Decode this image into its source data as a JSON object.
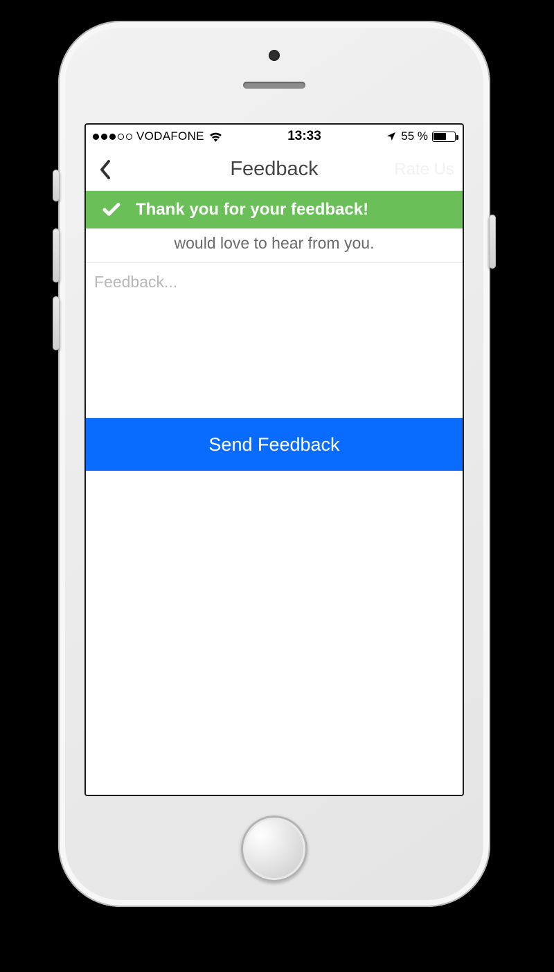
{
  "status": {
    "carrier": "VODAFONE",
    "time": "13:33",
    "battery_text": "55 %",
    "battery_fill_pct": 55
  },
  "nav": {
    "title": "Feedback",
    "rate_label": "Rate Us"
  },
  "toast": {
    "message": "Thank you for your feedback!"
  },
  "intro": {
    "line": "would love to hear from you."
  },
  "feedback_input": {
    "placeholder": "Feedback...",
    "value": ""
  },
  "send_button": {
    "label": "Send Feedback"
  },
  "colors": {
    "toast_bg": "#6bbf59",
    "primary_button": "#0a6cff"
  }
}
